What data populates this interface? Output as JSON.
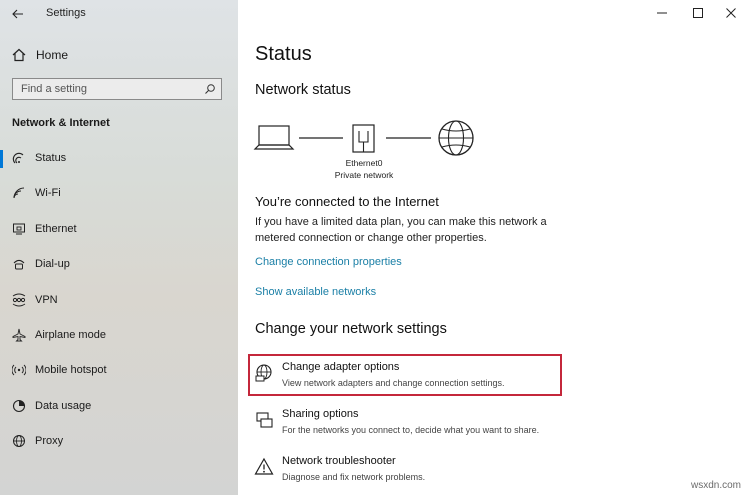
{
  "window": {
    "title": "Settings",
    "controls": [
      "minimize",
      "maximize",
      "close"
    ]
  },
  "sidebar": {
    "home_label": "Home",
    "search_placeholder": "Find a setting",
    "section_title": "Network & Internet",
    "items": [
      {
        "label": "Status",
        "icon": "status-icon",
        "active": true
      },
      {
        "label": "Wi-Fi",
        "icon": "wifi-icon"
      },
      {
        "label": "Ethernet",
        "icon": "ethernet-icon"
      },
      {
        "label": "Dial-up",
        "icon": "dialup-icon"
      },
      {
        "label": "VPN",
        "icon": "vpn-icon"
      },
      {
        "label": "Airplane mode",
        "icon": "airplane-icon"
      },
      {
        "label": "Mobile hotspot",
        "icon": "hotspot-icon"
      },
      {
        "label": "Data usage",
        "icon": "data-usage-icon"
      },
      {
        "label": "Proxy",
        "icon": "globe-icon"
      }
    ]
  },
  "main": {
    "title": "Status",
    "network_status_heading": "Network status",
    "diagram": {
      "adapter_name": "Ethernet0",
      "network_type": "Private network"
    },
    "connected_heading": "You’re connected to the Internet",
    "connected_text": "If you have a limited data plan, you can make this network a metered connection or change other properties.",
    "links": {
      "change_connection": "Change connection properties",
      "show_networks": "Show available networks"
    },
    "change_settings_heading": "Change your network settings",
    "options": [
      {
        "title": "Change adapter options",
        "desc": "View network adapters and change connection settings.",
        "icon": "adapter-icon",
        "highlighted": true
      },
      {
        "title": "Sharing options",
        "desc": "For the networks you connect to, decide what you want to share.",
        "icon": "sharing-icon"
      },
      {
        "title": "Network troubleshooter",
        "desc": "Diagnose and fix network problems.",
        "icon": "warning-icon"
      }
    ]
  },
  "watermark": "wsxdn.com",
  "colors": {
    "accent": "#0078d7",
    "link": "#1a7fa6",
    "highlight": "#c4273b"
  }
}
